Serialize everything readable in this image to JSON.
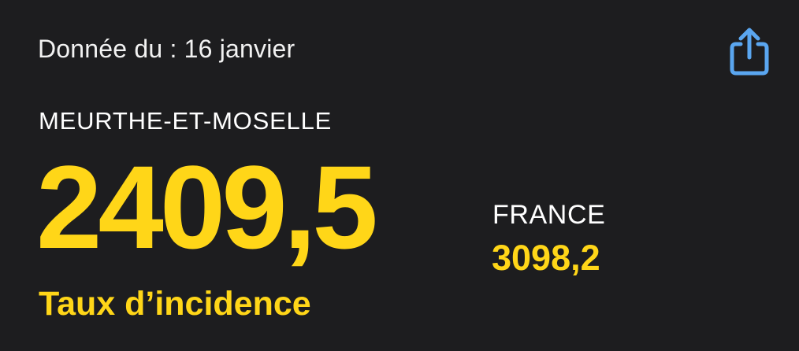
{
  "header": {
    "date_text": "Donnée du : 16 janvier",
    "share_icon": "share-icon"
  },
  "region": {
    "name": "MEURTHE-ET-MOSELLE",
    "value": "2409,5",
    "metric_label": "Taux d’incidence"
  },
  "comparison": {
    "name": "FRANCE",
    "value": "3098,2"
  },
  "colors": {
    "background": "#1d1d1f",
    "accent": "#ffd618",
    "text": "#ffffff",
    "share_icon": "#5aa6f0"
  }
}
